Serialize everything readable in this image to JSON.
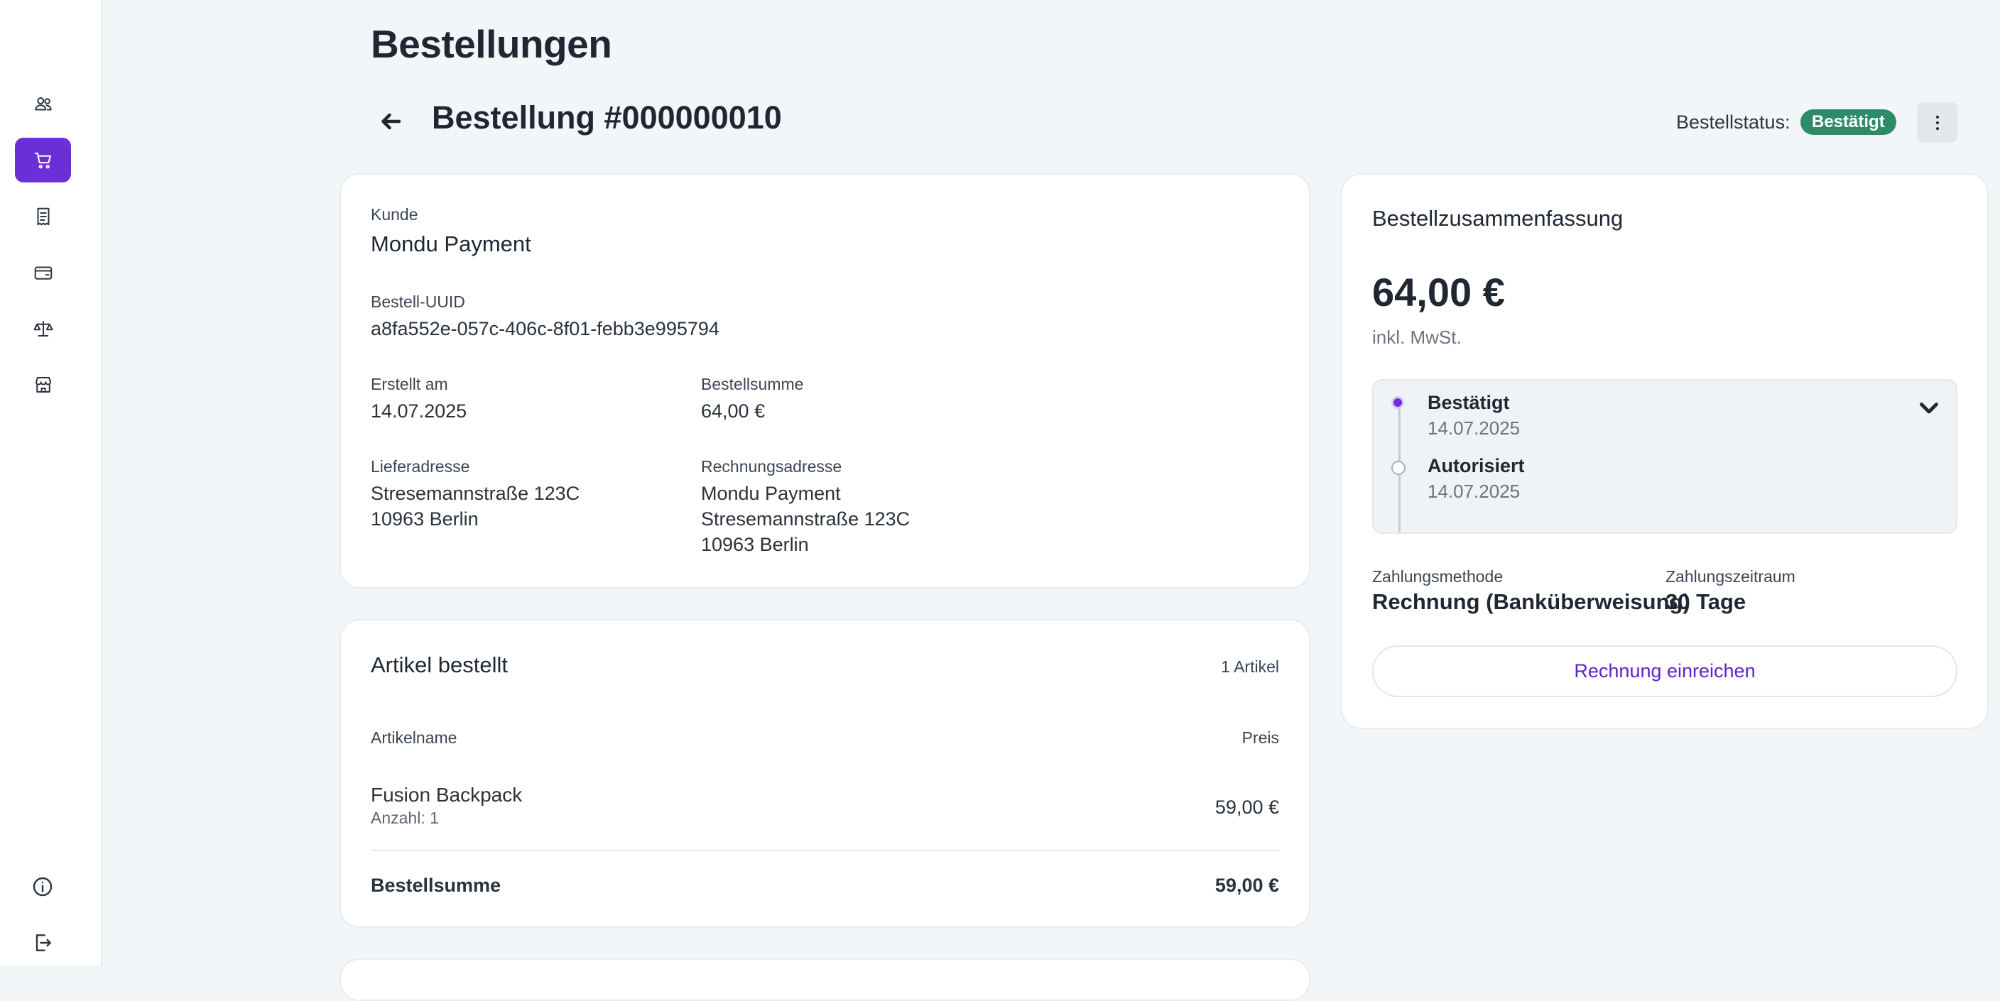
{
  "sidebar": {
    "items": [
      {
        "icon": "users-icon",
        "active": false
      },
      {
        "icon": "shopping-cart-icon",
        "active": true
      },
      {
        "icon": "receipt-icon",
        "active": false
      },
      {
        "icon": "wallet-icon",
        "active": false
      },
      {
        "icon": "scale-icon",
        "active": false
      },
      {
        "icon": "store-icon",
        "active": false
      }
    ],
    "bottom": [
      {
        "icon": "info-icon"
      },
      {
        "icon": "logout-icon"
      }
    ]
  },
  "header": {
    "page_title": "Bestellungen",
    "order_title": "Bestellung #000000010",
    "status_label": "Bestellstatus:",
    "status_value": "Bestätigt"
  },
  "details": {
    "customer_label": "Kunde",
    "customer_name": "Mondu Payment",
    "uuid_label": "Bestell-UUID",
    "uuid_value": "a8fa552e-057c-406c-8f01-febb3e995794",
    "created_label": "Erstellt am",
    "created_value": "14.07.2025",
    "total_label": "Bestellsumme",
    "total_value": "64,00 €",
    "shipping_label": "Lieferadresse",
    "shipping_lines": [
      "Stresemannstraße 123C",
      "10963 Berlin"
    ],
    "billing_label": "Rechnungsadresse",
    "billing_lines": [
      "Mondu Payment",
      "Stresemannstraße 123C",
      "10963 Berlin"
    ]
  },
  "items": {
    "title": "Artikel bestellt",
    "count": "1 Artikel",
    "col_name": "Artikelname",
    "col_price": "Preis",
    "rows": [
      {
        "name": "Fusion Backpack",
        "qty": "Anzahl: 1",
        "price": "59,00 €"
      }
    ],
    "total_label": "Bestellsumme",
    "total_value": "59,00 €"
  },
  "summary": {
    "title": "Bestellzusammenfassung",
    "amount": "64,00 €",
    "tax_note": "inkl. MwSt.",
    "timeline": [
      {
        "title": "Bestätigt",
        "date": "14.07.2025"
      },
      {
        "title": "Autorisiert",
        "date": "14.07.2025"
      }
    ],
    "payment_method_label": "Zahlungsmethode",
    "payment_method_value": "Rechnung (Banküberweisung)",
    "payment_term_label": "Zahlungszeitraum",
    "payment_term_value": "30 Tage",
    "invoice_button": "Rechnung einreichen"
  },
  "colors": {
    "accent": "#6a2fd6",
    "status_green": "#2e8b6a",
    "background": "#f3f6f8"
  }
}
